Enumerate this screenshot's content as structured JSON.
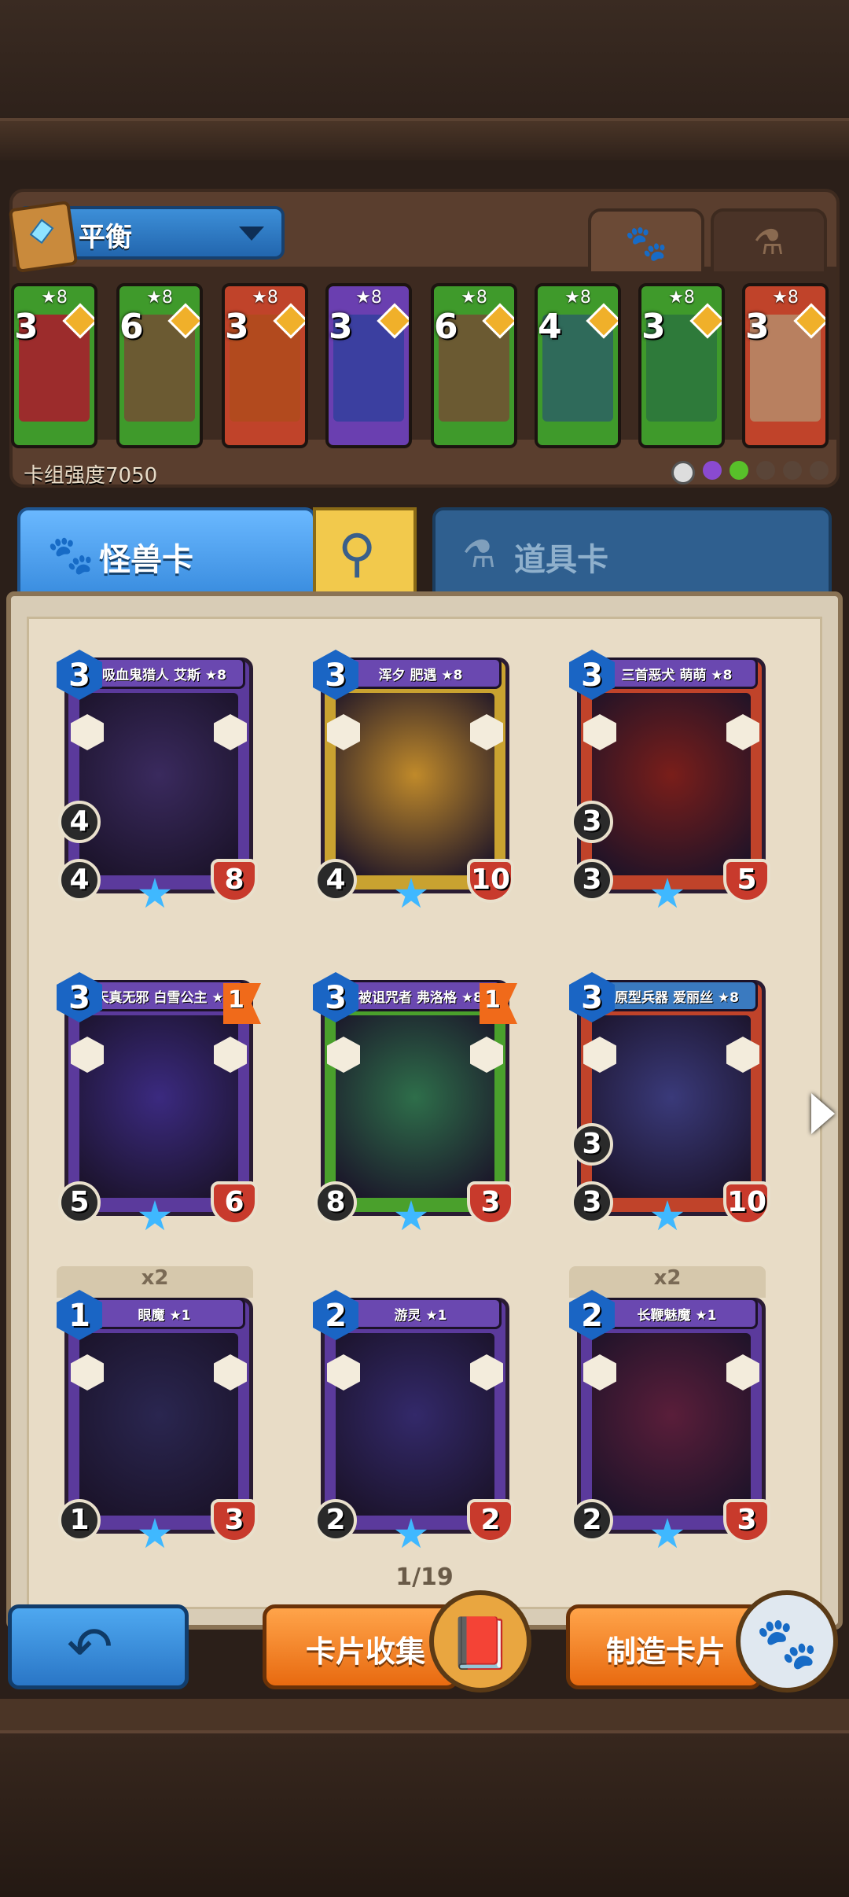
{
  "deck": {
    "name": "平衡",
    "strength_text": "卡组强度7050",
    "mini_cards": [
      {
        "cost": "3",
        "stars": "★8",
        "color": "#3f9a2b",
        "art": "#9c2c2c"
      },
      {
        "cost": "6",
        "stars": "★8",
        "color": "#3f9a2b",
        "art": "#6b5a32"
      },
      {
        "cost": "3",
        "stars": "★8",
        "color": "#c0432a",
        "art": "#b24a1e"
      },
      {
        "cost": "3",
        "stars": "★8",
        "color": "#6a3fb0",
        "art": "#3b3fa0"
      },
      {
        "cost": "6",
        "stars": "★8",
        "color": "#3f9a2b",
        "art": "#6b5a32"
      },
      {
        "cost": "4",
        "stars": "★8",
        "color": "#3f9a2b",
        "art": "#2f6a5a"
      },
      {
        "cost": "3",
        "stars": "★8",
        "color": "#3f9a2b",
        "art": "#2e7a3a"
      },
      {
        "cost": "3",
        "stars": "★8",
        "color": "#c0432a",
        "art": "#b88060"
      }
    ]
  },
  "tabs": {
    "monster": "怪兽卡",
    "items": "道具卡"
  },
  "icons": {
    "paw": "paw-icon",
    "potion": "potion-icon",
    "search": "magnifier-icon",
    "back": "back-arrow-icon",
    "next": "right-arrow-icon"
  },
  "cards": [
    {
      "title": "吸血鬼猎人 艾斯 ★8",
      "cost": "3",
      "attack": "4",
      "second": "4",
      "hp": "8",
      "frame": "#5b3a9c",
      "art": "#3a2a5e",
      "banner": "#6a48b0"
    },
    {
      "title": "浑夕 肥遇 ★8",
      "cost": "3",
      "attack": "4",
      "second": "",
      "hp": "10",
      "frame": "#c9a230",
      "art": "#c08a2a",
      "banner": "#6a48b0"
    },
    {
      "title": "三首恶犬 萌萌 ★8",
      "cost": "3",
      "attack": "3",
      "second": "3",
      "hp": "5",
      "frame": "#c0432a",
      "art": "#7a1e1a",
      "banner": "#6a48b0"
    },
    {
      "title": "天真无邪 白雪公主 ★8",
      "cost": "3",
      "attack": "5",
      "second": "",
      "hp": "6",
      "frame": "#5b3a9c",
      "art": "#3b2a80",
      "banner": "#6a48b0",
      "flag": "1"
    },
    {
      "title": "被诅咒者 弗洛格 ★8",
      "cost": "3",
      "attack": "8",
      "second": "",
      "hp": "3",
      "frame": "#4aa02c",
      "art": "#2e6e4a",
      "banner": "#6a48b0",
      "flag": "1"
    },
    {
      "title": "原型兵器 爱丽丝 ★8",
      "cost": "3",
      "attack": "3",
      "second": "3",
      "hp": "10",
      "frame": "#c0432a",
      "art": "#3a3a7a",
      "banner": "#3a7ac0"
    },
    {
      "title": "眼魔 ★1",
      "cost": "1",
      "attack": "1",
      "second": "",
      "hp": "3",
      "frame": "#5b3a9c",
      "art": "#2a2650",
      "banner": "#6a48b0",
      "dup": "x2"
    },
    {
      "title": "游灵 ★1",
      "cost": "2",
      "attack": "2",
      "second": "",
      "hp": "2",
      "frame": "#5b3a9c",
      "art": "#33296a",
      "banner": "#6a48b0"
    },
    {
      "title": "长鞭魅魔 ★1",
      "cost": "2",
      "attack": "2",
      "second": "",
      "hp": "3",
      "frame": "#5b3a9c",
      "art": "#5a1e3a",
      "banner": "#6a48b0",
      "dup": "x2"
    }
  ],
  "pager": "1/19",
  "buttons": {
    "collect": "卡片收集",
    "craft": "制造卡片"
  }
}
